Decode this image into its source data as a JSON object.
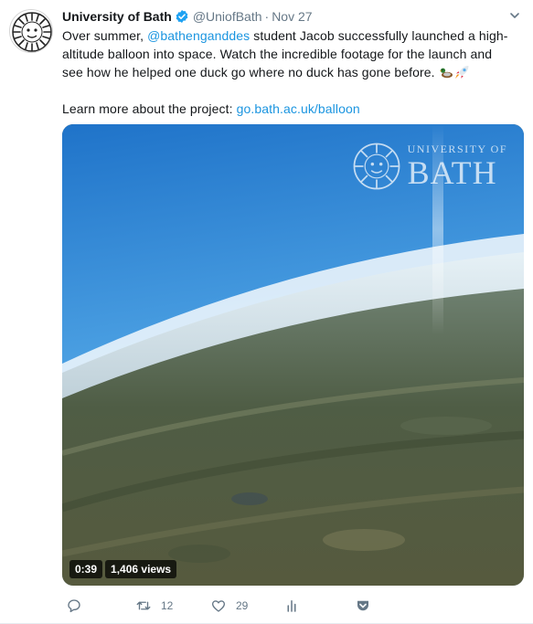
{
  "tweet": {
    "author_name": "University of Bath",
    "handle": "@UniofBath",
    "separator": "·",
    "date": "Nov 27",
    "text": {
      "part1": "Over summer, ",
      "mention": "@bathenganddes",
      "part2": " student Jacob successfully launched a high-altitude balloon into space. Watch the incredible footage for the launch and see how he helped one duck go where no duck has gone before. ",
      "emoji": [
        "duck",
        "rocket"
      ],
      "learn_more": "Learn more about the project: ",
      "link": "go.bath.ac.uk/balloon"
    }
  },
  "media": {
    "watermark_top": "UNIVERSITY OF",
    "watermark_main": "BATH",
    "duration": "0:39",
    "views": "1,406 views"
  },
  "actions": {
    "replies": "",
    "retweets": "12",
    "likes": "29"
  },
  "colors": {
    "link": "#1b95e0",
    "muted": "#657786",
    "verified": "#1da1f2"
  },
  "icons": [
    "reply-icon",
    "retweet-icon",
    "like-icon",
    "analytics-icon",
    "chevron-down-icon",
    "verified-icon"
  ]
}
